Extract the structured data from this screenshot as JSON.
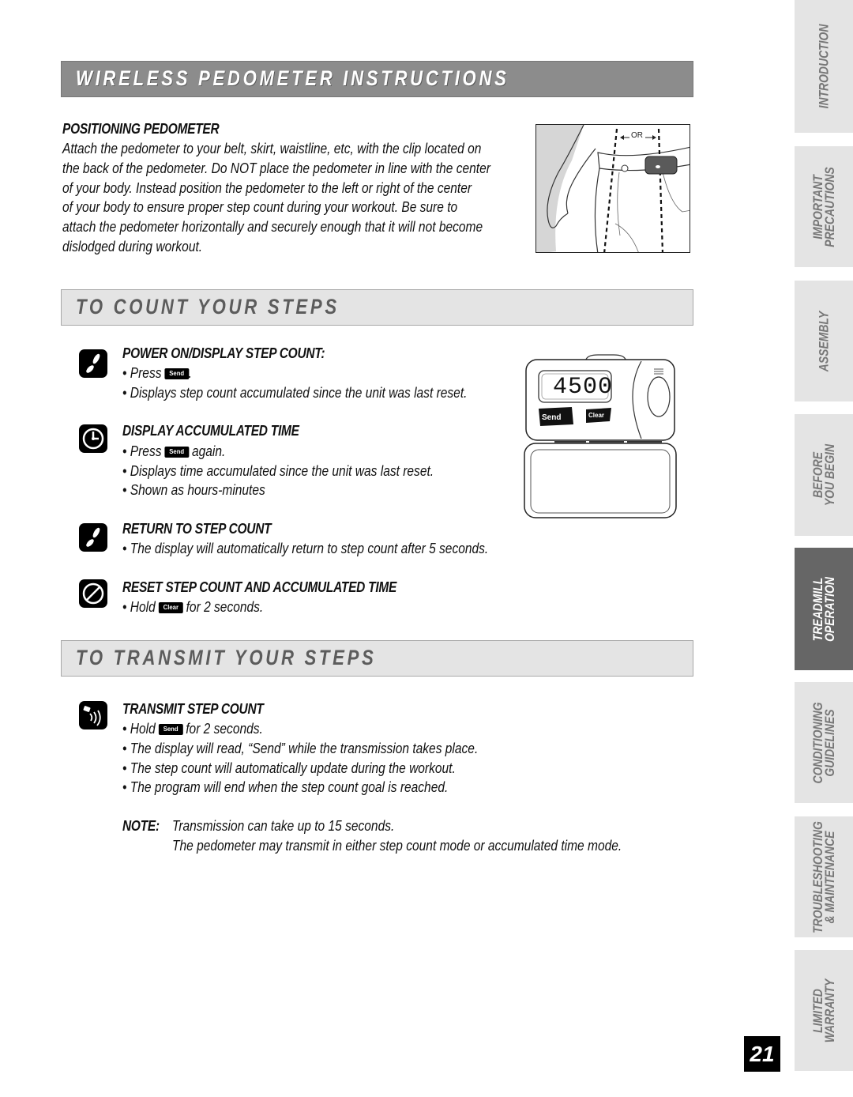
{
  "header": {
    "title": "WIRELESS PEDOMETER INSTRUCTIONS"
  },
  "positioning": {
    "heading": "POSITIONING PEDOMETER",
    "lines": [
      "Attach the pedometer to your belt, skirt, waistline, etc, with the clip located on",
      "the back of the pedometer.  Do NOT place the pedometer in line with the center",
      "of your body.  Instead position the pedometer to the left or right of the center",
      "of your body to ensure proper step count during your workout.  Be sure to",
      "attach the pedometer horizontally and securely enough that it will not become",
      "dislodged during workout."
    ],
    "illustration_label": "OR"
  },
  "count_section": {
    "title": "TO COUNT YOUR STEPS",
    "steps": [
      {
        "icon": "footsteps-icon",
        "heading": "POWER ON/DISPLAY STEP COUNT:",
        "lines": [
          {
            "pre": "• Press ",
            "key": "Send",
            "post": "."
          },
          {
            "pre": "• Displays step count accumulated since the unit was last reset."
          }
        ]
      },
      {
        "icon": "clock-icon",
        "heading": "DISPLAY ACCUMULATED TIME",
        "lines": [
          {
            "pre": "• Press ",
            "key": "Send",
            "post": " again."
          },
          {
            "pre": "• Displays time accumulated since the unit was last reset."
          },
          {
            "pre": "• Shown as hours-minutes"
          }
        ]
      },
      {
        "icon": "footsteps-icon",
        "heading": "RETURN TO STEP COUNT",
        "lines": [
          {
            "pre": "• The display will automatically return to step count after 5 seconds."
          }
        ]
      },
      {
        "icon": "no-sign-icon",
        "heading": "RESET STEP COUNT AND ACCUMULATED TIME",
        "lines": [
          {
            "pre": "• Hold ",
            "key": "Clear",
            "post": " for 2 seconds."
          }
        ]
      }
    ],
    "device": {
      "display_value": "4500",
      "send_label": "Send",
      "clear_label": "Clear"
    }
  },
  "transmit_section": {
    "title": "TO TRANSMIT YOUR STEPS",
    "step": {
      "icon": "transmit-icon",
      "heading": "TRANSMIT STEP COUNT",
      "lines": [
        {
          "pre": "• Hold ",
          "key": "Send",
          "post": " for 2 seconds."
        },
        {
          "pre": "• The display will read, “Send” while the transmission takes place."
        },
        {
          "pre": "• The step count will automatically update during the workout."
        },
        {
          "pre": "• The program will end when the step count goal is reached."
        }
      ]
    },
    "note": {
      "label": "NOTE:",
      "lines": [
        "Transmission can take up to 15 seconds.",
        "The pedometer may transmit in either step count mode or accumulated time mode."
      ]
    }
  },
  "side_tabs": [
    {
      "label": "INTRODUCTION",
      "active": false
    },
    {
      "label": "IMPORTANT\nPRECAUTIONS",
      "active": false
    },
    {
      "label": "ASSEMBLY",
      "active": false
    },
    {
      "label": "BEFORE\nYOU BEGIN",
      "active": false
    },
    {
      "label": "TREADMILL\nOPERATION",
      "active": true
    },
    {
      "label": "CONDITIONING\nGUIDELINES",
      "active": false
    },
    {
      "label": "TROUBLESHOOTING\n& MAINTENANCE",
      "active": false
    },
    {
      "label": "LIMITED\nWARRANTY",
      "active": false
    }
  ],
  "page_number": "21"
}
